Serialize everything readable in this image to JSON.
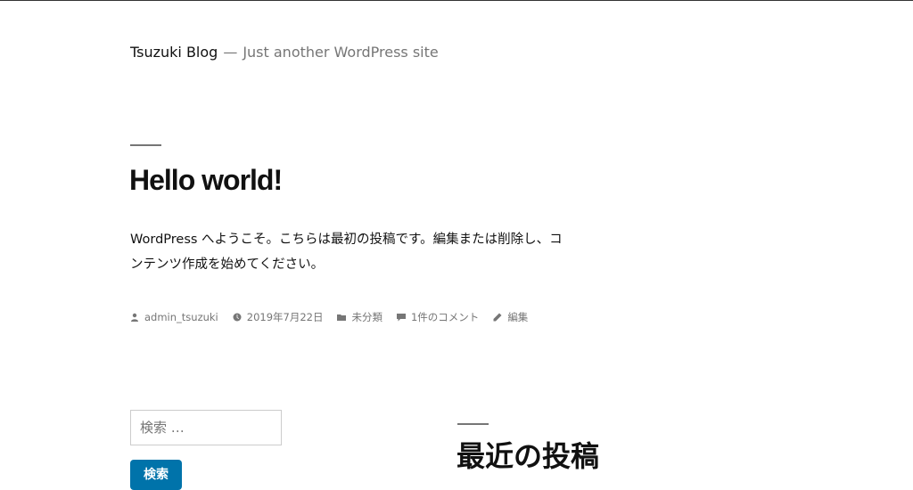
{
  "site": {
    "title": "Tsuzuki Blog",
    "separator": "—",
    "description": "Just another WordPress site"
  },
  "post": {
    "title": "Hello world!",
    "content": "WordPress へようこそ。こちらは最初の投稿です。編集または削除し、コンテンツ作成を始めてください。",
    "meta": {
      "author": "admin_tsuzuki",
      "date": "2019年7月22日",
      "category": "未分類",
      "comments": "1件のコメント",
      "edit": "編集"
    }
  },
  "search": {
    "placeholder": "検索 …",
    "button_label": "検索"
  },
  "widget": {
    "recent_posts_title": "最近の投稿"
  },
  "colors": {
    "text": "#111111",
    "muted": "#767676",
    "button": "#0073aa"
  },
  "icons": {
    "author": "person-icon",
    "date": "clock-icon",
    "category": "folder-icon",
    "comments": "comment-icon",
    "edit": "pencil-icon"
  }
}
